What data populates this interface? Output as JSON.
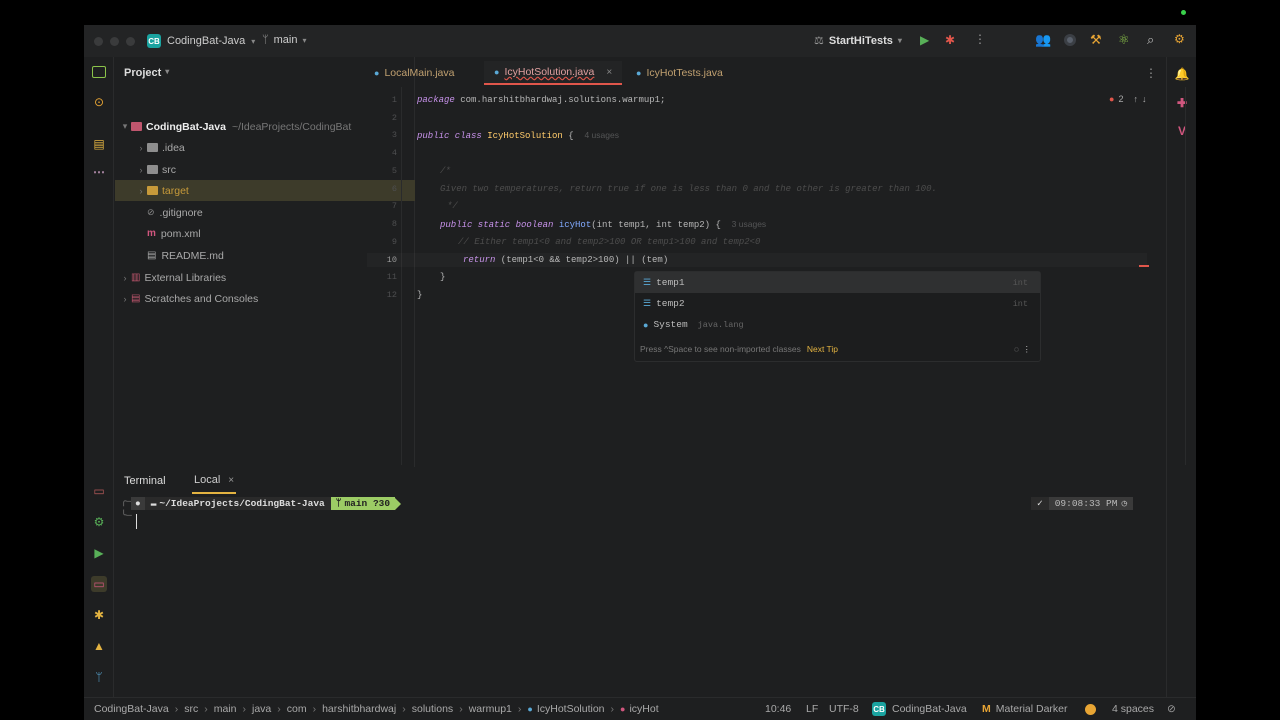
{
  "titlebar": {
    "app_badge": "CB",
    "project_name": "CodingBat-Java",
    "branch": "main",
    "run_config": "StartHiTests"
  },
  "project_panel": {
    "title": "Project",
    "tree": [
      {
        "label": "CodingBat-Java",
        "path": "~/IdeaProjects/CodingBat",
        "type": "root"
      },
      {
        "label": ".idea",
        "type": "folder"
      },
      {
        "label": "src",
        "type": "folder"
      },
      {
        "label": "target",
        "type": "folder"
      },
      {
        "label": ".gitignore",
        "type": "file"
      },
      {
        "label": "pom.xml",
        "type": "file"
      },
      {
        "label": "README.md",
        "type": "file"
      },
      {
        "label": "External Libraries",
        "type": "lib"
      },
      {
        "label": "Scratches and Consoles",
        "type": "lib"
      }
    ]
  },
  "tabs": [
    {
      "label": "LocalMain.java"
    },
    {
      "label": "IcyHotSolution.java",
      "active": true
    },
    {
      "label": "IcyHotTests.java"
    }
  ],
  "editor": {
    "problems_count": "2",
    "lines": [
      "1",
      "2",
      "3",
      "4",
      "5",
      "6",
      "7",
      "8",
      "9",
      "10",
      "11",
      "12"
    ],
    "line1_kw": "package",
    "line1_rest": " com.harshitbhardwaj.solutions.warmup1;",
    "line3_kw": "public class",
    "line3_name": " IcyHotSolution",
    "line3_rest": " {",
    "line3_hint": "4 usages",
    "line5": "/*",
    "line6": "Given two temperatures, return true if one is less than 0 and the other is greater than 100.",
    "line7": "*/",
    "line8_kw": "public static boolean",
    "line8_fn": " icyHot",
    "line8_rest": "(int temp1, int temp2) {",
    "line8_hint": "3 usages",
    "line9": "// Either temp1<0 and temp2>100 OR temp1>100 and temp2<0",
    "line10_kw": "return",
    "line10_rest": " (temp1<0 && temp2>100) || (tem)",
    "line11": "}",
    "line12": "}"
  },
  "completion": {
    "items": [
      {
        "name": "temp1",
        "type": "int"
      },
      {
        "name": "temp2",
        "type": "int"
      },
      {
        "name": "System",
        "type": "java.lang"
      }
    ],
    "footer": "Press ^Space to see non-imported classes",
    "next_tip": "Next Tip"
  },
  "terminal": {
    "title": "Terminal",
    "tab": "Local",
    "path": "~/IdeaProjects/CodingBat-Java",
    "git": "main ?30",
    "time": "09:08:33 PM"
  },
  "statusbar": {
    "breadcrumbs": [
      "CodingBat-Java",
      "src",
      "main",
      "java",
      "com",
      "harshitbhardwaj",
      "solutions",
      "warmup1",
      "IcyHotSolution",
      "icyHot"
    ],
    "position": "10:46",
    "line_sep": "LF",
    "encoding": "UTF-8",
    "project": "CodingBat-Java",
    "theme": "Material Darker",
    "indent": "4 spaces"
  }
}
